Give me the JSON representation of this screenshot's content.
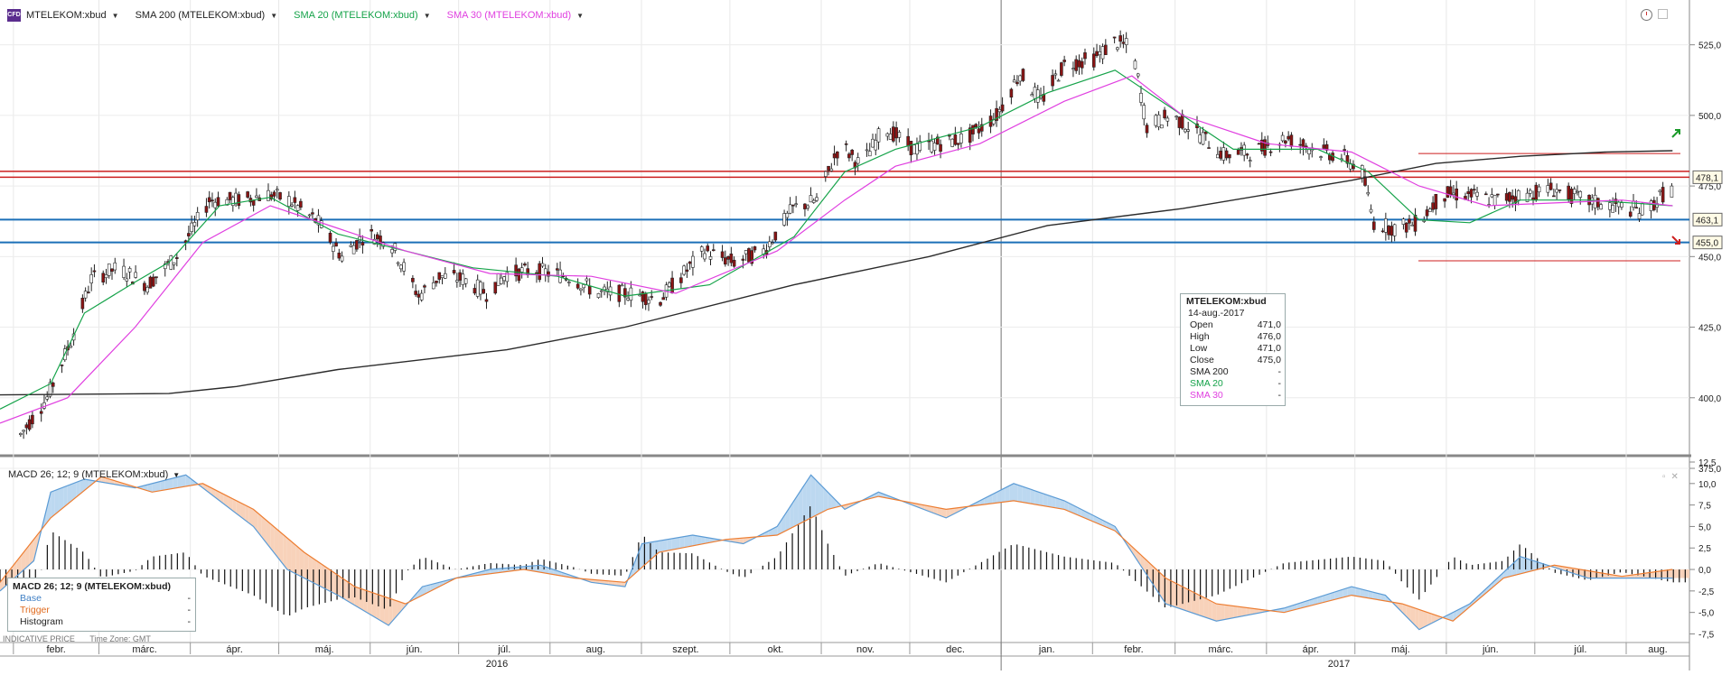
{
  "header": {
    "logo": "CFD",
    "instrument": "MTELEKOM:xbud",
    "sma200": "SMA 200 (MTELEKOM:xbud)",
    "sma20": "SMA 20 (MTELEKOM:xbud)",
    "sma30": "SMA 30 (MTELEKOM:xbud)"
  },
  "colors": {
    "sma200": "#2b2b2b",
    "sma20": "#16a34a",
    "sma30": "#e040e0",
    "red": "#cc1f1f",
    "blue": "#1b6fb8",
    "base": "#5b9bd5",
    "trigger": "#ed7d31"
  },
  "icons": [
    "clock-icon",
    "window-icon",
    "buy-signal-icon",
    "sell-signal-icon",
    "close-icon"
  ],
  "tooltip_price": {
    "title": "MTELEKOM:xbud",
    "date": "14-aug.-2017",
    "rows": [
      {
        "label": "Open",
        "value": "471,0"
      },
      {
        "label": "High",
        "value": "476,0"
      },
      {
        "label": "Low",
        "value": "471,0"
      },
      {
        "label": "Close",
        "value": "475,0"
      },
      {
        "label": "SMA 200",
        "value": "-"
      },
      {
        "label": "SMA 20",
        "value": "-"
      },
      {
        "label": "SMA 30",
        "value": "-"
      }
    ]
  },
  "macd": {
    "header": "MACD 26; 12; 9 (MTELEKOM:xbud)",
    "tooltip_title": "MACD 26; 12; 9 (MTELEKOM:xbud)",
    "rows": [
      {
        "label": "Base",
        "value": "-"
      },
      {
        "label": "Trigger",
        "value": "-"
      },
      {
        "label": "Histogram",
        "value": "-"
      }
    ]
  },
  "footer": {
    "price_type": "INDICATIVE PRICE",
    "timezone": "Time Zone: GMT"
  },
  "chart_data": [
    {
      "type": "candlestick",
      "ylim": [
        375,
        530
      ],
      "yticks": [
        "375,0",
        "400,0",
        "425,0",
        "450,0",
        "475,0",
        "500,0",
        "525,0"
      ],
      "x_months": [
        "febr.",
        "márc.",
        "ápr.",
        "máj.",
        "jún.",
        "júl.",
        "aug.",
        "szept.",
        "okt.",
        "nov.",
        "dec.",
        "jan.",
        "febr.",
        "márc.",
        "ápr.",
        "máj.",
        "jún.",
        "júl.",
        "aug."
      ],
      "x_years": [
        "2016",
        "2017"
      ],
      "close_path": [
        [
          "2016-02-01",
          387
        ],
        [
          "2016-02-10",
          400
        ],
        [
          "2016-02-18",
          420
        ],
        [
          "2016-02-25",
          442
        ],
        [
          "2016-03-05",
          446
        ],
        [
          "2016-03-15",
          440
        ],
        [
          "2016-03-25",
          450
        ],
        [
          "2016-04-05",
          470
        ],
        [
          "2016-04-15",
          470
        ],
        [
          "2016-04-25",
          472
        ],
        [
          "2016-05-02",
          470
        ],
        [
          "2016-05-12",
          462
        ],
        [
          "2016-05-20",
          450
        ],
        [
          "2016-05-28",
          458
        ],
        [
          "2016-06-05",
          456
        ],
        [
          "2016-06-15",
          436
        ],
        [
          "2016-06-22",
          443
        ],
        [
          "2016-06-30",
          442
        ],
        [
          "2016-07-08",
          437
        ],
        [
          "2016-07-15",
          444
        ],
        [
          "2016-07-25",
          445
        ],
        [
          "2016-08-05",
          443
        ],
        [
          "2016-08-15",
          437
        ],
        [
          "2016-08-25",
          437
        ],
        [
          "2016-09-05",
          435
        ],
        [
          "2016-09-12",
          443
        ],
        [
          "2016-09-20",
          452
        ],
        [
          "2016-09-30",
          448
        ],
        [
          "2016-10-10",
          452
        ],
        [
          "2016-10-20",
          467
        ],
        [
          "2016-10-28",
          470
        ],
        [
          "2016-11-05",
          490
        ],
        [
          "2016-11-12",
          482
        ],
        [
          "2016-11-20",
          496
        ],
        [
          "2016-11-30",
          488
        ],
        [
          "2016-12-08",
          490
        ],
        [
          "2016-12-18",
          492
        ],
        [
          "2016-12-28",
          500
        ],
        [
          "2017-01-05",
          515
        ],
        [
          "2017-01-12",
          505
        ],
        [
          "2017-01-20",
          518
        ],
        [
          "2017-01-30",
          520
        ],
        [
          "2017-02-06",
          526
        ],
        [
          "2017-02-12",
          524
        ],
        [
          "2017-02-17",
          496
        ],
        [
          "2017-02-25",
          500
        ],
        [
          "2017-03-05",
          495
        ],
        [
          "2017-03-15",
          486
        ],
        [
          "2017-03-25",
          487
        ],
        [
          "2017-04-05",
          492
        ],
        [
          "2017-04-15",
          488
        ],
        [
          "2017-04-25",
          485
        ],
        [
          "2017-05-01",
          480
        ],
        [
          "2017-05-05",
          462
        ],
        [
          "2017-05-12",
          460
        ],
        [
          "2017-05-20",
          462
        ],
        [
          "2017-05-28",
          472
        ],
        [
          "2017-06-05",
          472
        ],
        [
          "2017-06-15",
          470
        ],
        [
          "2017-06-25",
          472
        ],
        [
          "2017-07-05",
          474
        ],
        [
          "2017-07-15",
          470
        ],
        [
          "2017-07-25",
          468
        ],
        [
          "2017-08-05",
          466
        ],
        [
          "2017-08-14",
          475
        ]
      ],
      "sma200": [
        [
          0,
          401
        ],
        [
          0.1,
          401.5
        ],
        [
          0.14,
          404
        ],
        [
          0.2,
          410
        ],
        [
          0.3,
          417
        ],
        [
          0.37,
          425
        ],
        [
          0.47,
          440
        ],
        [
          0.55,
          450
        ],
        [
          0.62,
          461
        ],
        [
          0.7,
          467
        ],
        [
          0.8,
          477
        ],
        [
          0.85,
          483
        ],
        [
          0.9,
          485.5
        ],
        [
          0.95,
          487
        ],
        [
          0.99,
          487.5
        ]
      ],
      "sma20": [
        [
          0,
          396
        ],
        [
          0.03,
          405
        ],
        [
          0.05,
          430
        ],
        [
          0.08,
          441
        ],
        [
          0.1,
          448
        ],
        [
          0.13,
          468
        ],
        [
          0.16,
          471
        ],
        [
          0.2,
          458
        ],
        [
          0.24,
          452
        ],
        [
          0.28,
          446
        ],
        [
          0.33,
          443
        ],
        [
          0.37,
          436
        ],
        [
          0.42,
          440
        ],
        [
          0.47,
          457
        ],
        [
          0.5,
          480
        ],
        [
          0.53,
          488
        ],
        [
          0.58,
          496
        ],
        [
          0.62,
          508
        ],
        [
          0.66,
          516
        ],
        [
          0.69,
          504
        ],
        [
          0.73,
          488
        ],
        [
          0.78,
          488
        ],
        [
          0.81,
          480
        ],
        [
          0.84,
          463
        ],
        [
          0.87,
          462
        ],
        [
          0.9,
          470
        ],
        [
          0.94,
          470
        ],
        [
          0.99,
          468
        ]
      ],
      "sma30": [
        [
          0,
          391
        ],
        [
          0.04,
          400
        ],
        [
          0.08,
          425
        ],
        [
          0.12,
          455
        ],
        [
          0.16,
          468
        ],
        [
          0.2,
          460
        ],
        [
          0.24,
          452
        ],
        [
          0.29,
          444
        ],
        [
          0.35,
          443
        ],
        [
          0.4,
          437
        ],
        [
          0.46,
          452
        ],
        [
          0.5,
          470
        ],
        [
          0.53,
          482
        ],
        [
          0.58,
          490
        ],
        [
          0.63,
          505
        ],
        [
          0.67,
          514
        ],
        [
          0.7,
          500
        ],
        [
          0.75,
          490
        ],
        [
          0.8,
          487
        ],
        [
          0.84,
          475
        ],
        [
          0.88,
          468
        ],
        [
          0.92,
          469
        ],
        [
          0.96,
          470
        ],
        [
          0.99,
          468
        ]
      ],
      "hlines": [
        {
          "value": 480.2,
          "color": "red"
        },
        {
          "value": 478.1,
          "color": "red",
          "label": "478,1"
        },
        {
          "value": 463.1,
          "color": "blue",
          "label": "463,1"
        },
        {
          "value": 455.0,
          "color": "blue",
          "label": "455,0"
        }
      ],
      "right_labels": [
        "478,1",
        "475,0",
        "463,1",
        "455,0"
      ]
    },
    {
      "type": "macd",
      "ylim": [
        -8.5,
        12.5
      ],
      "yticks": [
        "-7,5",
        "-5,0",
        "-2,5",
        "0,0",
        "2,5",
        "5,0",
        "7,5",
        "10,0",
        "12,5"
      ],
      "series": [
        {
          "name": "Base",
          "values": [
            [
              0,
              -2.5
            ],
            [
              0.02,
              1
            ],
            [
              0.03,
              9
            ],
            [
              0.05,
              10.5
            ],
            [
              0.08,
              9.5
            ],
            [
              0.11,
              11
            ],
            [
              0.13,
              8
            ],
            [
              0.15,
              5
            ],
            [
              0.17,
              0
            ],
            [
              0.2,
              -3
            ],
            [
              0.23,
              -6.5
            ],
            [
              0.25,
              -2
            ],
            [
              0.29,
              0
            ],
            [
              0.32,
              0.5
            ],
            [
              0.35,
              -1.5
            ],
            [
              0.37,
              -2
            ],
            [
              0.38,
              3
            ],
            [
              0.41,
              4
            ],
            [
              0.44,
              3
            ],
            [
              0.46,
              5
            ],
            [
              0.48,
              11
            ],
            [
              0.5,
              7
            ],
            [
              0.52,
              9
            ],
            [
              0.56,
              6
            ],
            [
              0.6,
              10
            ],
            [
              0.63,
              8
            ],
            [
              0.66,
              5
            ],
            [
              0.69,
              -4
            ],
            [
              0.72,
              -6
            ],
            [
              0.76,
              -4.5
            ],
            [
              0.8,
              -2
            ],
            [
              0.82,
              -3
            ],
            [
              0.84,
              -7
            ],
            [
              0.87,
              -4
            ],
            [
              0.9,
              1.5
            ],
            [
              0.94,
              -1
            ],
            [
              0.99,
              -1
            ]
          ]
        },
        {
          "name": "Trigger",
          "values": [
            [
              0,
              -1.5
            ],
            [
              0.03,
              6
            ],
            [
              0.06,
              10.8
            ],
            [
              0.09,
              9
            ],
            [
              0.12,
              10
            ],
            [
              0.15,
              7
            ],
            [
              0.18,
              2
            ],
            [
              0.21,
              -2
            ],
            [
              0.24,
              -4
            ],
            [
              0.27,
              -1
            ],
            [
              0.31,
              0
            ],
            [
              0.34,
              -1
            ],
            [
              0.37,
              -1.5
            ],
            [
              0.39,
              2
            ],
            [
              0.43,
              3.5
            ],
            [
              0.46,
              4
            ],
            [
              0.49,
              7
            ],
            [
              0.52,
              8.5
            ],
            [
              0.56,
              7
            ],
            [
              0.6,
              8
            ],
            [
              0.63,
              7
            ],
            [
              0.66,
              4.5
            ],
            [
              0.69,
              -1
            ],
            [
              0.72,
              -4
            ],
            [
              0.76,
              -5
            ],
            [
              0.8,
              -3
            ],
            [
              0.83,
              -4
            ],
            [
              0.86,
              -6
            ],
            [
              0.89,
              -1
            ],
            [
              0.92,
              0.5
            ],
            [
              0.96,
              -0.8
            ],
            [
              0.99,
              0
            ]
          ]
        }
      ]
    }
  ]
}
